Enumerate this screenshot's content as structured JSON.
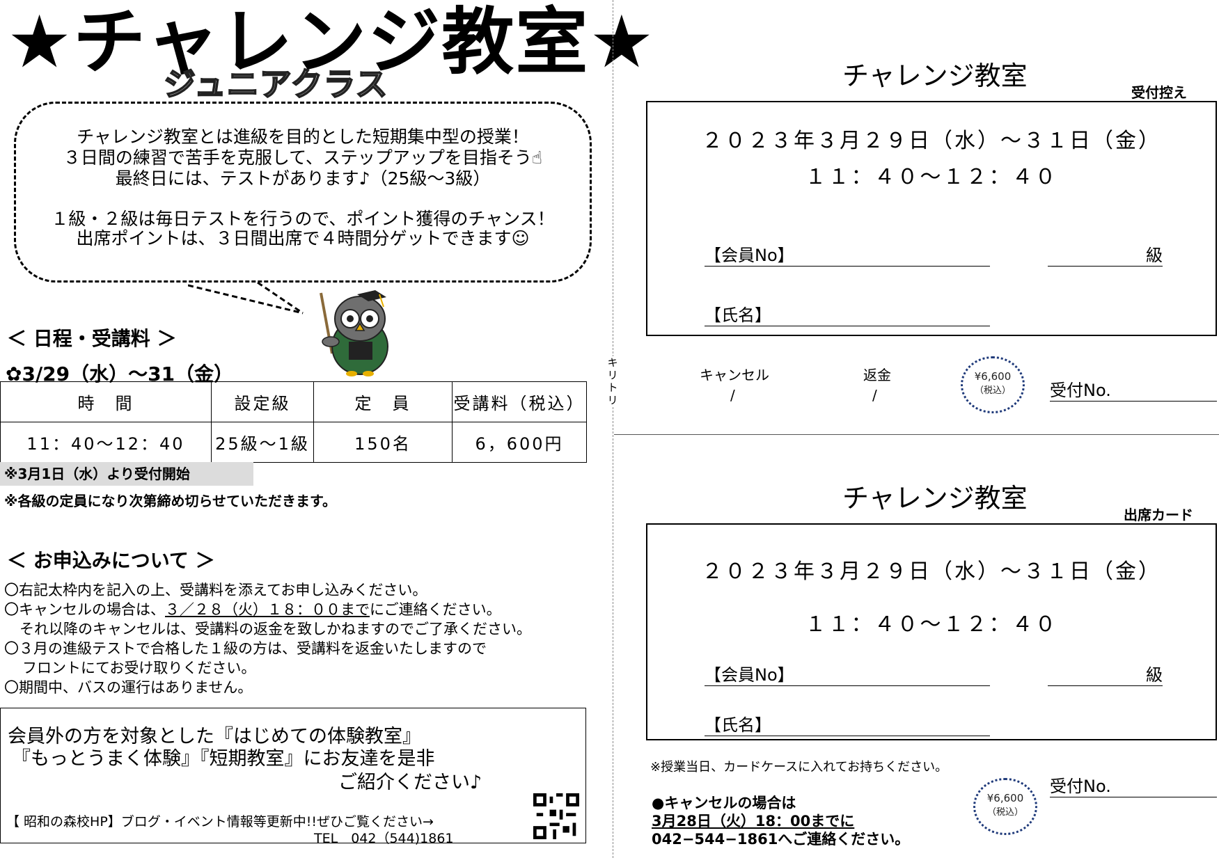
{
  "flyer": {
    "title": "★チャレンジ教室★",
    "subtitle": "ジュニアクラス",
    "bubble_lines": [
      "チャレンジ教室とは進級を目的とした短期集中型の授業！",
      "３日間の練習で苦手を克服して、ステップアップを目指そう☝",
      "最終日には、テストがあります♪（25級～3級）",
      "１級・２級は毎日テストを行うので、ポイント獲得のチャンス！",
      "出席ポイントは、３日間出席で４時間分ゲットできます☺"
    ],
    "schedule_heading": "＜ 日程・受講料 ＞",
    "date_line": "✿3/29（水）～31（金）",
    "table_headers": [
      "時　間",
      "設定級",
      "定　員",
      "受講料（税込）"
    ],
    "table_row": [
      "11：40～12：40",
      "25級～1級",
      "150名",
      "6，600円"
    ],
    "note_gray": "※3月1日（水）より受付開始",
    "note_capacity": "※各級の定員になり次第締め切らせていただきます。",
    "apply_heading": "＜ お申込みについて ＞",
    "apply_lines": [
      "〇右記太枠内を記入の上、受講料を添えてお申し込みください。",
      "〇キャンセルの場合は、",
      "３／２８（火）１８：００まで",
      "にご連絡ください。",
      "それ以降のキャンセルは、受講料の返金を致しかねますのでご了承ください。",
      "〇３月の進級テストで合格した１級の方は、受講料を返金いたしますので",
      "フロントにてお受け取りください。",
      "〇期間中、バスの運行はありません。"
    ],
    "promo_lines": [
      "会員外の方を対象とした『はじめての体験教室』",
      "『もっとうまく体験』『短期教室』にお友達を是非",
      "ご紹介ください♪"
    ],
    "hp_line": "【 昭和の森校HP】ブログ・イベント情報等更新中!!ぜひご覧ください→",
    "tel_line": "TEL　042（544)1861"
  },
  "cut_label": "キリトリ",
  "receipt": {
    "title": "チャレンジ教室",
    "tag": "受付控え",
    "date": "２０２３年３月２９日（水）～３１日（金）",
    "time": "１１：４０～１２：４０",
    "member_no_label": "【会員No】",
    "grade_label": "級",
    "name_label": "【氏名】",
    "cancel_label": "キャンセル",
    "refund_label": "返金",
    "slash": "/",
    "stamp_price": "¥6,600",
    "stamp_tax": "（税込）",
    "receipt_no_label": "受付No."
  },
  "attendance": {
    "title": "チャレンジ教室",
    "tag": "出席カード",
    "date": "２０２３年３月２９日（水）～３１日（金）",
    "time": "１１：４０～１２：４０",
    "member_no_label": "【会員No】",
    "grade_label": "級",
    "name_label": "【氏名】",
    "card_note": "※授業当日、カードケースに入れてお持ちください。",
    "receipt_no_label": "受付No.",
    "stamp_price": "¥6,600",
    "stamp_tax": "（税込）",
    "cancel_heading": "●キャンセルの場合は",
    "cancel_deadline": "3月28日（火）18：00までに",
    "cancel_contact": "042−544−1861へご連絡ください。"
  },
  "colors": {
    "stamp_border": "#1f3a7a",
    "gray_band": "#dcdcdc",
    "owl_body": "#6f6f6f",
    "owl_robe": "#2f6b3a"
  }
}
